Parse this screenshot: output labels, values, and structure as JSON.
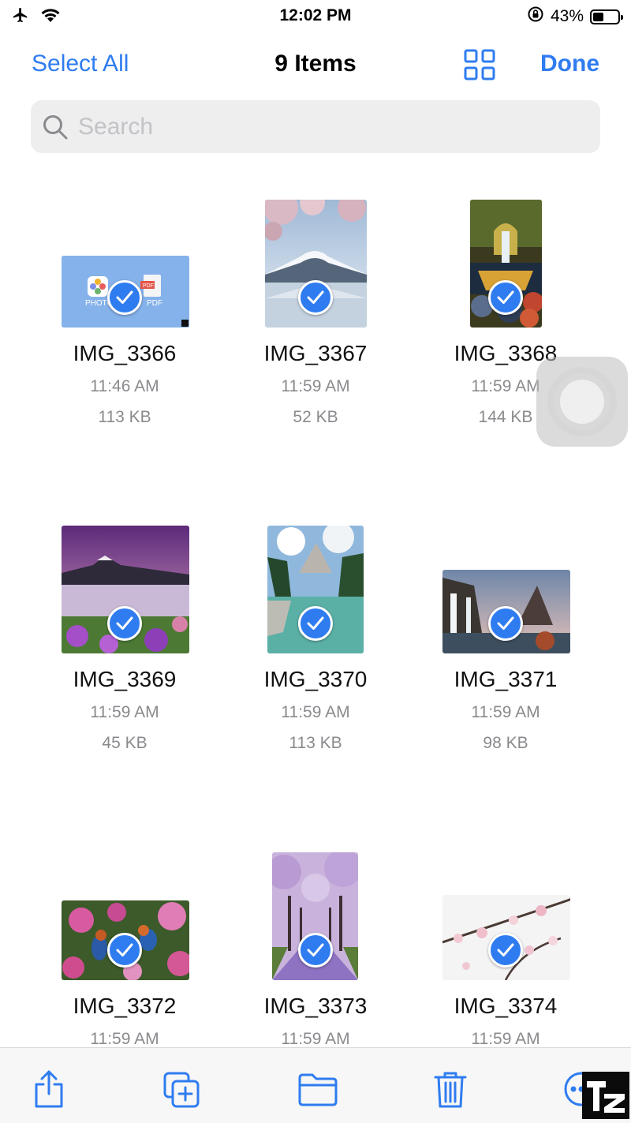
{
  "status_bar": {
    "time": "12:02 PM",
    "battery_percent": "43%",
    "battery_level": 0.43,
    "icons": [
      "airplane-icon",
      "wifi-icon",
      "orientation-lock-icon",
      "battery-icon"
    ]
  },
  "nav": {
    "select_all_label": "Select All",
    "title": "9 Items",
    "done_label": "Done",
    "view_toggle_icon": "grid-view-icon"
  },
  "search": {
    "placeholder": "Search",
    "value": ""
  },
  "files": [
    {
      "name": "IMG_3366",
      "time": "11:46 AM",
      "size": "113 KB",
      "selected": true
    },
    {
      "name": "IMG_3367",
      "time": "11:59 AM",
      "size": "52 KB",
      "selected": true
    },
    {
      "name": "IMG_3368",
      "time": "11:59 AM",
      "size": "144 KB",
      "selected": true
    },
    {
      "name": "IMG_3369",
      "time": "11:59 AM",
      "size": "45 KB",
      "selected": true
    },
    {
      "name": "IMG_3370",
      "time": "11:59 AM",
      "size": "113 KB",
      "selected": true
    },
    {
      "name": "IMG_3371",
      "time": "11:59 AM",
      "size": "98 KB",
      "selected": true
    },
    {
      "name": "IMG_3372",
      "time": "11:59 AM",
      "selected": true
    },
    {
      "name": "IMG_3373",
      "time": "11:59 AM",
      "selected": true
    },
    {
      "name": "IMG_3374",
      "time": "11:59 AM",
      "selected": true
    }
  ],
  "thumb_labels": {
    "photos": "PHOTO",
    "pdf_badge": "PDF",
    "pdf": "PDF"
  },
  "toolbar": {
    "icons": [
      "share-icon",
      "duplicate-icon",
      "move-folder-icon",
      "trash-icon",
      "more-icon"
    ]
  },
  "watermark": {
    "text": "TZ"
  },
  "colors": {
    "accent": "#2f7cf0"
  }
}
